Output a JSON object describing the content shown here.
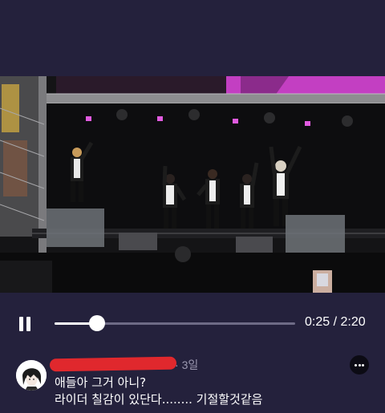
{
  "player": {
    "progress_fraction": 0.175,
    "time_display": "0:25 / 2:20"
  },
  "comment": {
    "author_redacted": true,
    "separator": "·",
    "age": "3일",
    "line1": "애들아 그거 아니?",
    "line2": "라이더 칠감이 있단다........ 기절할것같음"
  },
  "colors": {
    "background": "#24213c",
    "redaction": "#e0282d",
    "stage_light": "#d63fd6"
  },
  "icons": {
    "play_state": "pause-icon",
    "overflow": "more-horizontal-icon"
  }
}
